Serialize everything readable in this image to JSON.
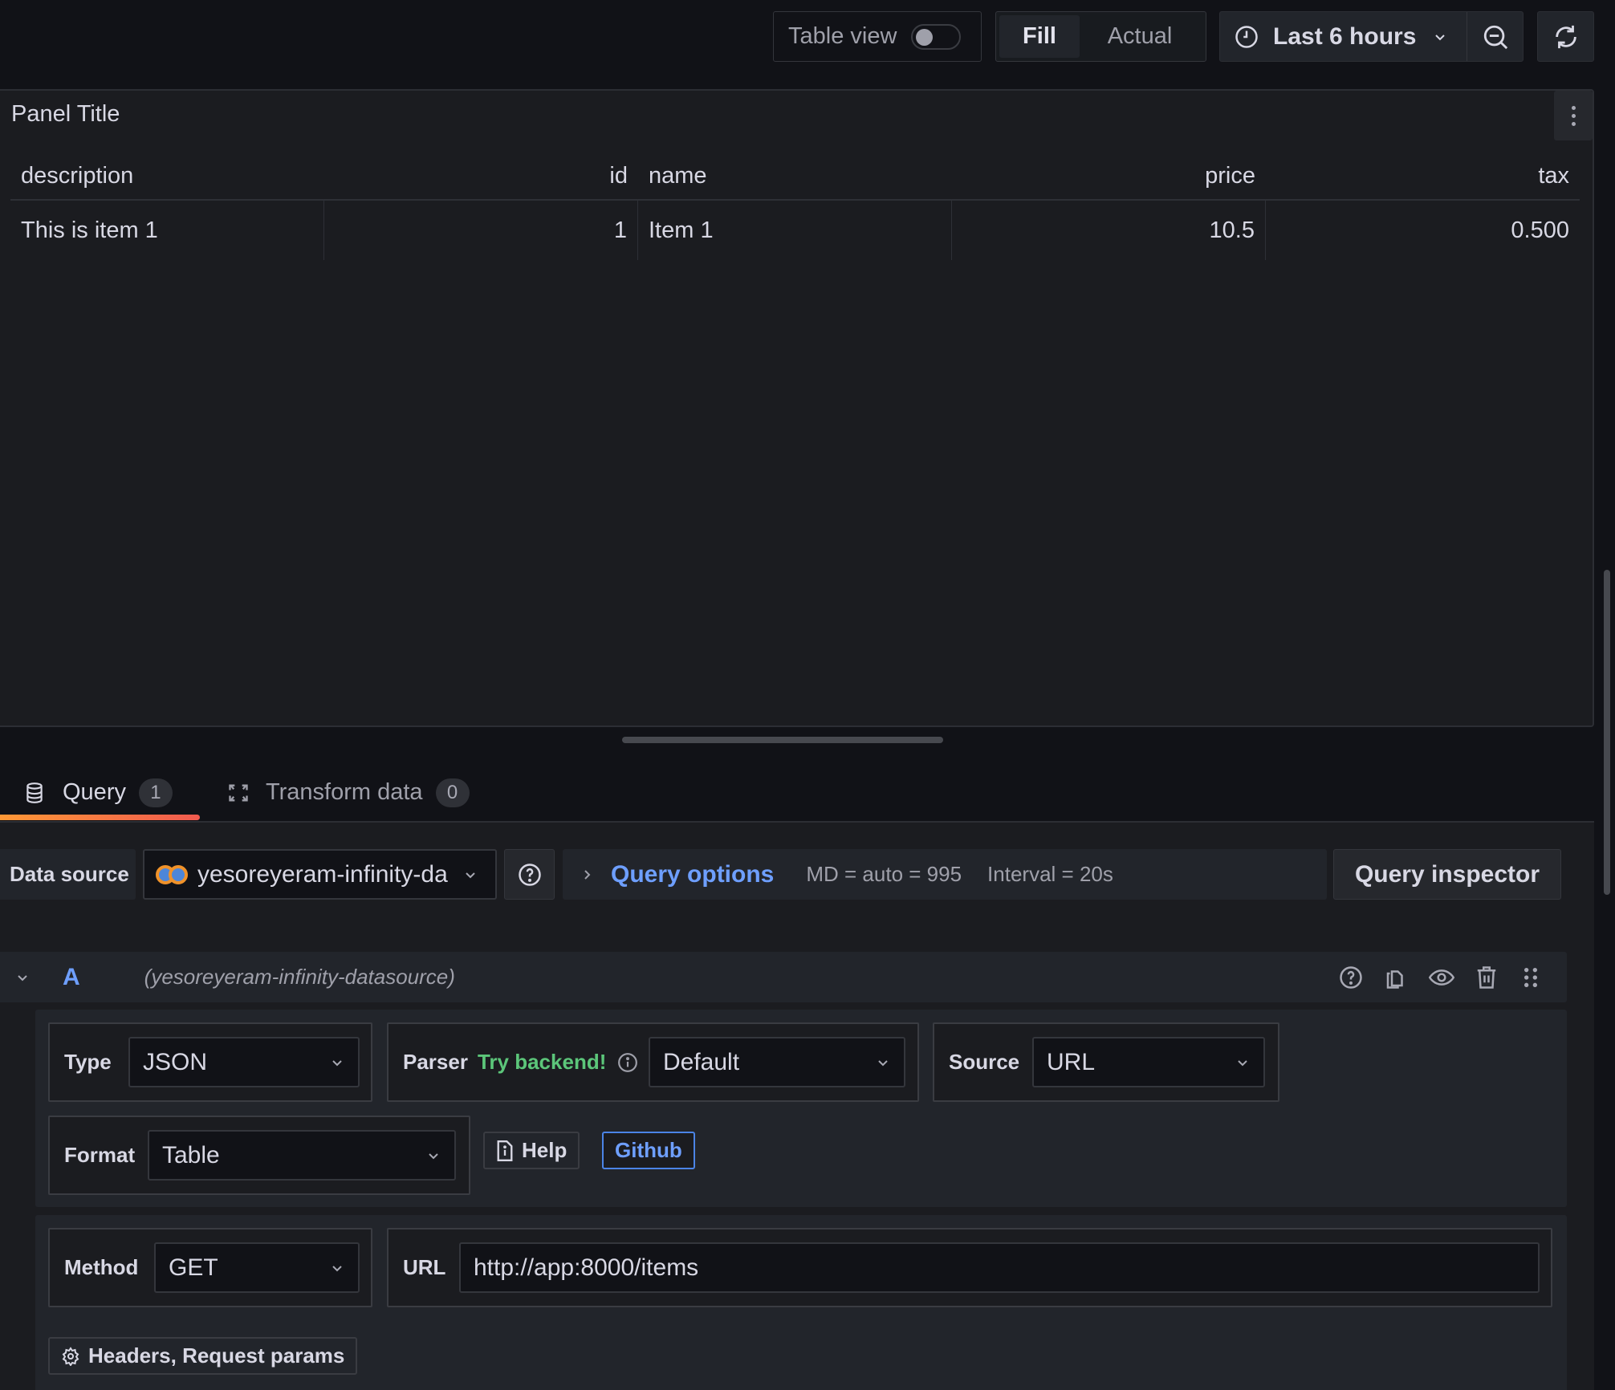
{
  "toolbar": {
    "table_view_label": "Table view",
    "table_view_on": false,
    "fill_label": "Fill",
    "actual_label": "Actual",
    "time_range": "Last 6 hours",
    "icons": {
      "clock": "clock-icon",
      "zoom_out": "zoom-out-icon",
      "refresh": "refresh-icon"
    }
  },
  "panel": {
    "title": "Panel Title",
    "columns": [
      "description",
      "id",
      "name",
      "price",
      "tax"
    ],
    "rows": [
      [
        "This is item 1",
        "1",
        "Item 1",
        "10.5",
        "0.500"
      ]
    ]
  },
  "tabs": [
    {
      "label": "Query",
      "count": "1",
      "active": true,
      "icon": "database-icon"
    },
    {
      "label": "Transform data",
      "count": "0",
      "active": false,
      "icon": "transform-icon"
    }
  ],
  "query_bar": {
    "data_source_label": "Data source",
    "data_source_value": "yesoreyeram-infinity-da",
    "query_options_label": "Query options",
    "md_text": "MD = auto = 995",
    "interval_text": "Interval = 20s",
    "inspector_label": "Query inspector"
  },
  "query": {
    "ref_id": "A",
    "datasource_name": "(yesoreyeram-infinity-datasource)",
    "type_label": "Type",
    "type_value": "JSON",
    "parser_label": "Parser",
    "parser_hint": "Try backend!",
    "parser_value": "Default",
    "source_label": "Source",
    "source_value": "URL",
    "format_label": "Format",
    "format_value": "Table",
    "help_label": "Help",
    "github_label": "Github",
    "method_label": "Method",
    "method_value": "GET",
    "url_label": "URL",
    "url_value": "http://app:8000/items",
    "headers_label": "Headers, Request params"
  },
  "colors": {
    "accent_blue": "#6e9fff",
    "accent_green": "#5cc67a",
    "tab_underline_start": "#ff9836",
    "tab_underline_end": "#f05a4f",
    "background": "#111217",
    "panel": "#1b1c20"
  }
}
